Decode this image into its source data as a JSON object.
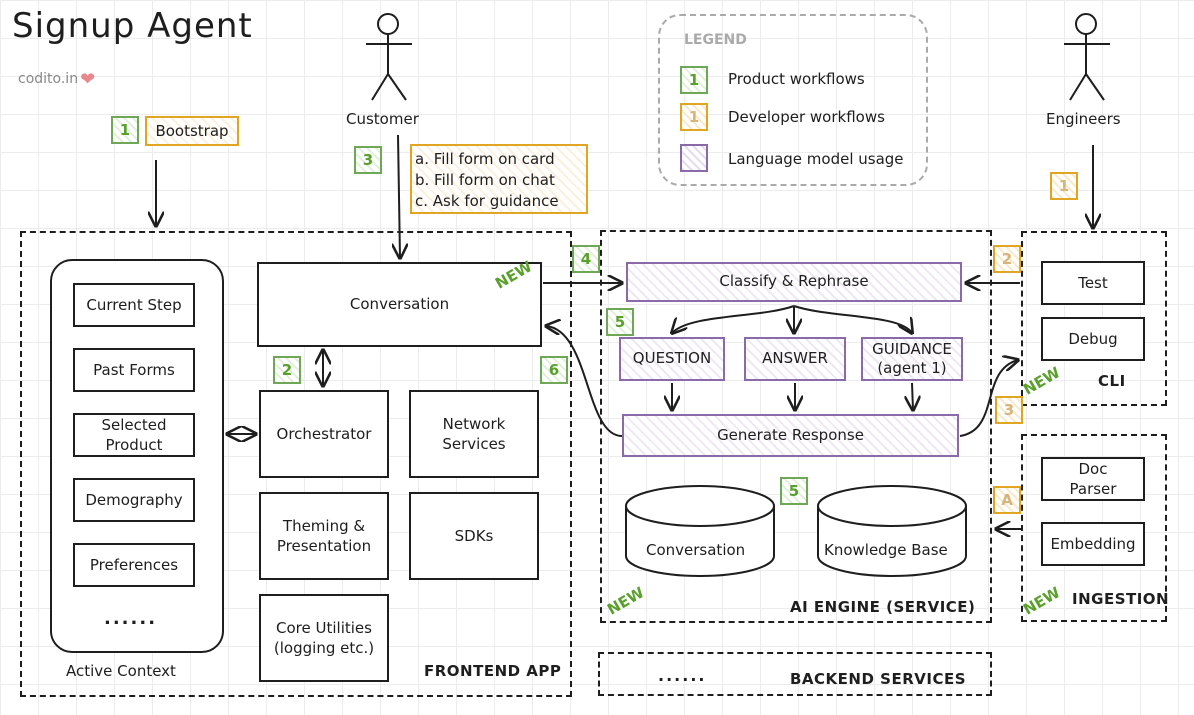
{
  "header": {
    "title": "Signup Agent",
    "subtitle": "codito.in",
    "heart_icon": "heart-icon"
  },
  "legend": {
    "title": "LEGEND",
    "items": [
      {
        "badge": "1",
        "label": "Product workflows",
        "color": "#6ea857"
      },
      {
        "badge": "1",
        "label": "Developer workflows",
        "color": "#e0a521"
      },
      {
        "badge": "",
        "label": "Language model usage",
        "color": "#8a6aa8"
      }
    ]
  },
  "actors": {
    "customer": "Customer",
    "engineers": "Engineers"
  },
  "bootstrap": {
    "badge": "1",
    "label": "Bootstrap"
  },
  "customer_actions": {
    "badge": "3",
    "items": [
      "a. Fill form on card",
      "b. Fill form on chat",
      "c. Ask for guidance"
    ]
  },
  "active_context": {
    "label": "Active Context",
    "items": [
      "Current Step",
      "Past Forms",
      "Selected Product",
      "Demography",
      "Preferences"
    ],
    "more": "......"
  },
  "frontend": {
    "label": "FRONTEND APP",
    "conversation": "Conversation",
    "new_tag": "NEW",
    "orchestrator": "Orchestrator",
    "network_services": "Network Services",
    "theming": "Theming & Presentation",
    "sdks": "SDKs",
    "core_utilities": "Core Utilities (logging etc.)",
    "badges": {
      "orchestrator": "2",
      "response": "6"
    }
  },
  "ai_engine": {
    "label": "AI ENGINE (SERVICE)",
    "new_tag": "NEW",
    "classify": "Classify & Rephrase",
    "question": "QUESTION",
    "answer": "ANSWER",
    "guidance_line1": "GUIDANCE",
    "guidance_line2": "(agent 1)",
    "generate": "Generate Response",
    "db_conversation": "Conversation",
    "db_knowledge": "Knowledge Base",
    "badges": {
      "request": "4",
      "classify": "5",
      "storage": "5"
    }
  },
  "cli": {
    "label": "CLI",
    "new_tag": "NEW",
    "test": "Test",
    "debug": "Debug",
    "badges": {
      "engineers": "1",
      "request": "2",
      "response": "3"
    }
  },
  "ingestion": {
    "label": "INGESTION",
    "new_tag": "NEW",
    "doc_parser": "Doc Parser",
    "embedding": "Embedding",
    "badge": "A"
  },
  "backend": {
    "label": "BACKEND SERVICES",
    "more": "......"
  }
}
